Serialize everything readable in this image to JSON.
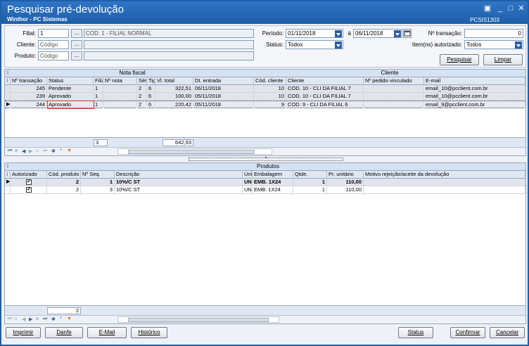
{
  "window": {
    "title": "Pesquisar pré-devolução",
    "subtitle": "Winthor - PC Sistemas",
    "code": "PCSIS1303",
    "controls": {
      "restore": "▣",
      "min": "_",
      "max": "□",
      "close": "✕"
    }
  },
  "filters": {
    "filial_label": "Filial:",
    "filial_value": "1",
    "filial_name": "COD. 1 - FILIAL NORMAL",
    "cliente_label": "Cliente:",
    "cliente_value": "Código",
    "produto_label": "Produto:",
    "produto_value": "Código",
    "periodo_label": "Período:",
    "periodo_from": "01/11/2018",
    "periodo_sep": "à",
    "periodo_to": "06/11/2018",
    "status_label": "Status:",
    "status_value": "Todos",
    "transacao_label": "Nº transação:",
    "transacao_value": "0",
    "itens_label": "Item(ns) autorizado:",
    "itens_value": "Todos",
    "ellipsis": "...",
    "pesquisar": "Pesquisar",
    "limpar": "Limpar"
  },
  "top_grid": {
    "group_nota": "Nota fiscal",
    "group_cliente": "Cliente",
    "columns": [
      "Nº transação",
      "Status",
      "Filial",
      "Nº nota",
      "Série",
      "Tipo",
      "Vl. total",
      "Dt. entrada",
      "Cód. cliente",
      "Cliente",
      "Nº pedido vinculado",
      "E-mail"
    ],
    "rows": [
      {
        "transacao": "245",
        "status": "Pendente",
        "filial": "1",
        "nota": "",
        "serie": "2",
        "tipo": "6",
        "total": "322,51",
        "data": "06/11/2018",
        "cod": "10",
        "cliente": "COD. 10 - CLI DA FILIAL 7",
        "pedido": "",
        "email": "email_10@pcclient.com.br"
      },
      {
        "transacao": "239",
        "status": "Aprovado",
        "filial": "1",
        "nota": "",
        "serie": "2",
        "tipo": "6",
        "total": "100,00",
        "data": "05/11/2018",
        "cod": "10",
        "cliente": "COD. 10 - CLI DA FILIAL 7",
        "pedido": "",
        "email": "email_10@pcclient.com.br"
      },
      {
        "transacao": "244",
        "status": "Aprovado",
        "filial": "1",
        "nota": "",
        "serie": "2",
        "tipo": "6",
        "total": "220,42",
        "data": "05/11/2018",
        "cod": "9",
        "cliente": "COD. 9 - CLI DA FILIAL 6",
        "pedido": "",
        "email": "email_9@pcclient.com.br"
      }
    ],
    "footer_count": "3",
    "footer_total": "642,93"
  },
  "bottom_grid": {
    "group_produtos": "Produtos",
    "columns": [
      "Autorizado",
      "Cód. produto",
      "Nº Seq.",
      "Descrição",
      "Unid.",
      "Embalagem",
      "Qtde.",
      "Pr. unitário",
      "Motivo rejeição/aceite da devolução"
    ],
    "rows": [
      {
        "autorizado": "✔",
        "cod": "2",
        "seq": "1",
        "desc": "10%/C ST",
        "un": "UN",
        "emb": "EMB. 1X24",
        "qtde": "1",
        "preco": "110,00",
        "motivo": ""
      },
      {
        "autorizado": "✔",
        "cod": "2",
        "seq": "3",
        "desc": "10%/C ST",
        "un": "UN",
        "emb": "EMB. 1X24",
        "qtde": "1",
        "preco": "110,00",
        "motivo": ""
      }
    ],
    "footer_count": "2"
  },
  "actions": {
    "imprimir": "Imprimir",
    "danfe": "Danfe",
    "email": "E-Mail",
    "historico": "Histórico",
    "status": "Status",
    "confirmar": "Confirmar",
    "cancelar": "Cancelar"
  },
  "colors": {
    "accent": "#1f5fa8",
    "highlight": "#e53935"
  }
}
